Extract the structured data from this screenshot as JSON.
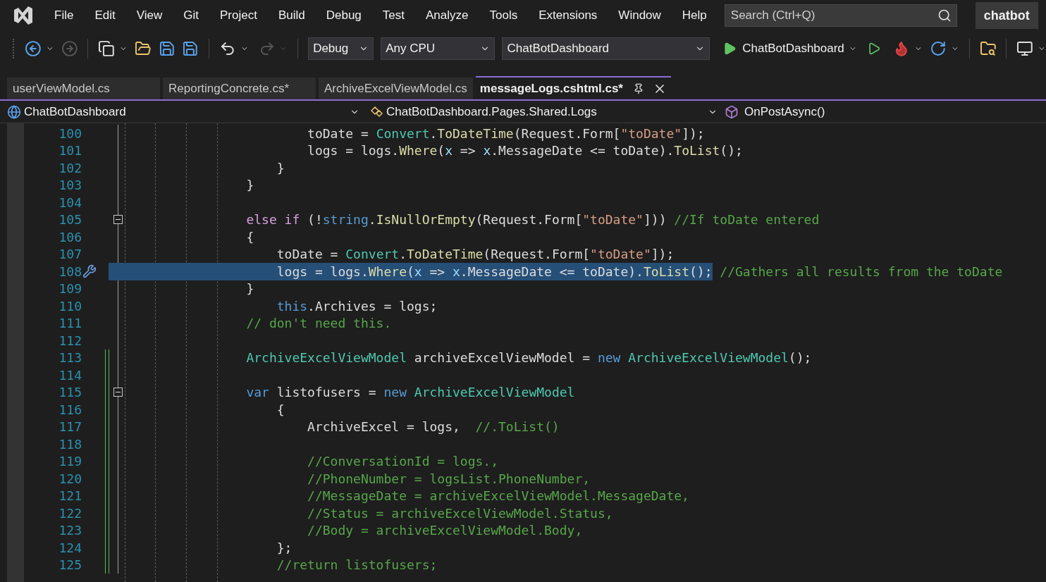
{
  "menu": [
    "File",
    "Edit",
    "View",
    "Git",
    "Project",
    "Build",
    "Debug",
    "Test",
    "Analyze",
    "Tools",
    "Extensions",
    "Window",
    "Help"
  ],
  "search": {
    "placeholder": "Search (Ctrl+Q)"
  },
  "solution_name": "chatbot",
  "toolbar": {
    "configuration": "Debug",
    "platform": "Any CPU",
    "startup_project": "ChatBotDashboard",
    "run_label": "ChatBotDashboard"
  },
  "tabs": [
    {
      "label": "userViewModel.cs",
      "selected": false
    },
    {
      "label": "ReportingConcrete.cs*",
      "selected": false
    },
    {
      "label": "ArchiveExcelViewModel.cs",
      "selected": false
    },
    {
      "label": "messageLogs.cshtml.cs*",
      "selected": true
    }
  ],
  "navigation": {
    "project": "ChatBotDashboard",
    "type": "ChatBotDashboard.Pages.Shared.Logs",
    "member": "OnPostAsync()"
  },
  "lines": [
    {
      "number": "100",
      "tokens": [
        {
          "t": "                        toDate = ",
          "kind": "plain"
        },
        {
          "t": "Convert",
          "kind": "type"
        },
        {
          "t": ".",
          "kind": "plain"
        },
        {
          "t": "ToDateTime",
          "kind": "method"
        },
        {
          "t": "(Request.Form[",
          "kind": "plain"
        },
        {
          "t": "\"toDate\"",
          "kind": "string"
        },
        {
          "t": "]);",
          "kind": "plain"
        }
      ],
      "collapsible": false,
      "changed": false,
      "selected": false,
      "quick_action": false
    },
    {
      "number": "101",
      "tokens": [
        {
          "t": "                        logs = logs.",
          "kind": "plain"
        },
        {
          "t": "Where",
          "kind": "method"
        },
        {
          "t": "(",
          "kind": "plain"
        },
        {
          "t": "x",
          "kind": "param"
        },
        {
          "t": " => ",
          "kind": "plain"
        },
        {
          "t": "x",
          "kind": "param"
        },
        {
          "t": ".MessageDate <= toDate).",
          "kind": "plain"
        },
        {
          "t": "ToList",
          "kind": "method"
        },
        {
          "t": "();",
          "kind": "plain"
        }
      ],
      "collapsible": false,
      "changed": false,
      "selected": false,
      "quick_action": false
    },
    {
      "number": "102",
      "tokens": [
        {
          "t": "                    }",
          "kind": "plain"
        }
      ],
      "collapsible": false,
      "changed": false,
      "selected": false,
      "quick_action": false
    },
    {
      "number": "103",
      "tokens": [
        {
          "t": "                }",
          "kind": "plain"
        }
      ],
      "collapsible": false,
      "changed": false,
      "selected": false,
      "quick_action": false
    },
    {
      "number": "104",
      "collapsible": false,
      "changed": false,
      "selected": false,
      "quick_action": false
    },
    {
      "number": "105",
      "tokens": [
        {
          "t": "                else if",
          "kind": "control"
        },
        {
          "t": " (!",
          "kind": "plain"
        },
        {
          "t": "string",
          "kind": "keyword"
        },
        {
          "t": ".",
          "kind": "plain"
        },
        {
          "t": "IsNullOrEmpty",
          "kind": "method"
        },
        {
          "t": "(Request.Form[",
          "kind": "plain"
        },
        {
          "t": "\"toDate\"",
          "kind": "string"
        },
        {
          "t": "])) ",
          "kind": "plain"
        },
        {
          "t": "//If toDate entered",
          "kind": "comment"
        }
      ],
      "collapsible": true,
      "changed": false,
      "selected": false,
      "quick_action": false
    },
    {
      "number": "106",
      "tokens": [
        {
          "t": "                {",
          "kind": "plain"
        }
      ],
      "collapsible": false,
      "changed": false,
      "selected": false,
      "quick_action": false
    },
    {
      "number": "107",
      "tokens": [
        {
          "t": "                    toDate = ",
          "kind": "plain"
        },
        {
          "t": "Convert",
          "kind": "type"
        },
        {
          "t": ".",
          "kind": "plain"
        },
        {
          "t": "ToDateTime",
          "kind": "method"
        },
        {
          "t": "(Request.Form[",
          "kind": "plain"
        },
        {
          "t": "\"toDate\"",
          "kind": "string"
        },
        {
          "t": "]);",
          "kind": "plain"
        }
      ],
      "collapsible": false,
      "changed": false,
      "selected": false,
      "quick_action": false
    },
    {
      "number": "108",
      "tokens": [
        {
          "t": "                    logs = logs.",
          "kind": "plain"
        },
        {
          "t": "Where",
          "kind": "method"
        },
        {
          "t": "(",
          "kind": "plain"
        },
        {
          "t": "x",
          "kind": "param"
        },
        {
          "t": " => ",
          "kind": "plain"
        },
        {
          "t": "x",
          "kind": "param"
        },
        {
          "t": ".MessageDate <= toDate).",
          "kind": "plain"
        },
        {
          "t": "ToList",
          "kind": "method"
        },
        {
          "t": "();",
          "kind": "plain"
        },
        {
          "t": " //Gathers all results from the toDate",
          "kind": "comment"
        }
      ],
      "collapsible": false,
      "changed": false,
      "selected": true,
      "quick_action": true
    },
    {
      "number": "109",
      "tokens": [
        {
          "t": "                }",
          "kind": "plain"
        }
      ],
      "collapsible": false,
      "changed": false,
      "selected": false,
      "quick_action": false
    },
    {
      "number": "110",
      "tokens": [
        {
          "t": "                    this",
          "kind": "keyword"
        },
        {
          "t": ".Archives = logs;",
          "kind": "plain"
        }
      ],
      "collapsible": false,
      "changed": false,
      "selected": false,
      "quick_action": false
    },
    {
      "number": "111",
      "tokens": [
        {
          "t": "                // don't need this.",
          "kind": "comment"
        }
      ],
      "collapsible": false,
      "changed": false,
      "selected": false,
      "quick_action": false
    },
    {
      "number": "112",
      "collapsible": false,
      "changed": false,
      "selected": false,
      "quick_action": false
    },
    {
      "number": "113",
      "tokens": [
        {
          "t": "                ArchiveExcelViewModel",
          "kind": "type"
        },
        {
          "t": " archiveExcelViewModel = ",
          "kind": "plain"
        },
        {
          "t": "new ",
          "kind": "keyword"
        },
        {
          "t": "ArchiveExcelViewModel",
          "kind": "type"
        },
        {
          "t": "();",
          "kind": "plain"
        }
      ],
      "collapsible": false,
      "changed": true,
      "selected": false,
      "quick_action": false
    },
    {
      "number": "114",
      "collapsible": false,
      "changed": true,
      "selected": false,
      "quick_action": false
    },
    {
      "number": "115",
      "tokens": [
        {
          "t": "                var",
          "kind": "keyword"
        },
        {
          "t": " listofusers = ",
          "kind": "plain"
        },
        {
          "t": "new ",
          "kind": "keyword"
        },
        {
          "t": "ArchiveExcelViewModel",
          "kind": "type"
        }
      ],
      "collapsible": true,
      "changed": true,
      "selected": false,
      "quick_action": false
    },
    {
      "number": "116",
      "tokens": [
        {
          "t": "                    {",
          "kind": "plain"
        }
      ],
      "collapsible": false,
      "changed": true,
      "selected": false,
      "quick_action": false
    },
    {
      "number": "117",
      "tokens": [
        {
          "t": "                        ArchiveExcel = logs,  ",
          "kind": "plain"
        },
        {
          "t": "//.ToList()",
          "kind": "comment"
        }
      ],
      "collapsible": false,
      "changed": true,
      "selected": false,
      "quick_action": false
    },
    {
      "number": "118",
      "collapsible": false,
      "changed": true,
      "selected": false,
      "quick_action": false
    },
    {
      "number": "119",
      "tokens": [
        {
          "t": "                        //ConversationId = logs.,",
          "kind": "comment"
        }
      ],
      "collapsible": false,
      "changed": true,
      "selected": false,
      "quick_action": false
    },
    {
      "number": "120",
      "tokens": [
        {
          "t": "                        //PhoneNumber = logsList.PhoneNumber,",
          "kind": "comment"
        }
      ],
      "collapsible": false,
      "changed": true,
      "selected": false,
      "quick_action": false
    },
    {
      "number": "121",
      "tokens": [
        {
          "t": "                        //MessageDate = archiveExcelViewModel.MessageDate,",
          "kind": "comment"
        }
      ],
      "collapsible": false,
      "changed": true,
      "selected": false,
      "quick_action": false
    },
    {
      "number": "122",
      "tokens": [
        {
          "t": "                        //Status = archiveExcelViewModel.Status,",
          "kind": "comment"
        }
      ],
      "collapsible": false,
      "changed": true,
      "selected": false,
      "quick_action": false
    },
    {
      "number": "123",
      "tokens": [
        {
          "t": "                        //Body = archiveExcelViewModel.Body,",
          "kind": "comment"
        }
      ],
      "collapsible": false,
      "changed": true,
      "selected": false,
      "quick_action": false
    },
    {
      "number": "124",
      "tokens": [
        {
          "t": "                    };",
          "kind": "plain"
        }
      ],
      "collapsible": false,
      "changed": true,
      "selected": false,
      "quick_action": false
    },
    {
      "number": "125",
      "tokens": [
        {
          "t": "                    //return listofusers;",
          "kind": "comment"
        }
      ],
      "collapsible": false,
      "changed": true,
      "selected": false,
      "quick_action": false
    }
  ]
}
